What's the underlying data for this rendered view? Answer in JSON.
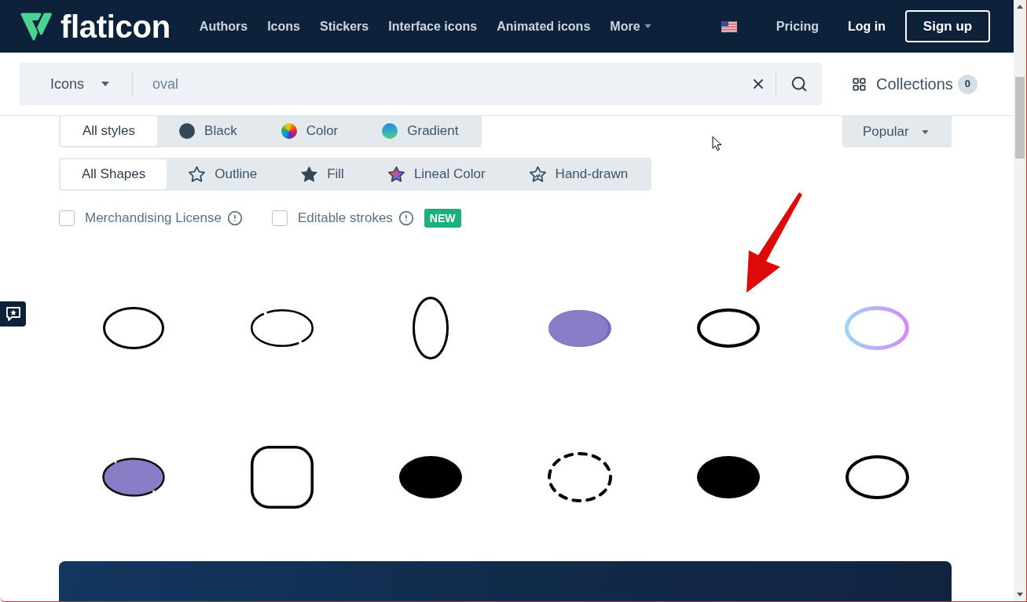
{
  "header": {
    "logo": "flaticon",
    "nav": [
      {
        "label": "Authors",
        "kind": "link"
      },
      {
        "label": "Icons",
        "kind": "link"
      },
      {
        "label": "Stickers",
        "kind": "link"
      },
      {
        "label": "Interface icons",
        "kind": "link"
      },
      {
        "label": "Animated icons",
        "kind": "link"
      },
      {
        "label": "More",
        "kind": "dropdown"
      }
    ],
    "pricing": "Pricing",
    "login": "Log in",
    "signup": "Sign up"
  },
  "search": {
    "category": "Icons",
    "value": "oval"
  },
  "collections": {
    "label": "Collections",
    "count": "0"
  },
  "style_filters": [
    {
      "label": "All styles",
      "kind": "all",
      "selected": true
    },
    {
      "label": "Black",
      "kind": "black",
      "selected": false
    },
    {
      "label": "Color",
      "kind": "color",
      "selected": false
    },
    {
      "label": "Gradient",
      "kind": "gradient",
      "selected": false
    }
  ],
  "sort": {
    "label": "Popular"
  },
  "shape_filters": [
    {
      "label": "All Shapes",
      "kind": "all",
      "selected": true
    },
    {
      "label": "Outline",
      "kind": "outline",
      "selected": false
    },
    {
      "label": "Fill",
      "kind": "fill",
      "selected": false
    },
    {
      "label": "Lineal Color",
      "kind": "lineal",
      "selected": false
    },
    {
      "label": "Hand-drawn",
      "kind": "handdrawn",
      "selected": false
    }
  ],
  "options": [
    {
      "label": "Merchandising License",
      "checked": false
    },
    {
      "label": "Editable strokes",
      "checked": false,
      "badge": "NEW"
    }
  ],
  "results": [
    {
      "kind": "outline"
    },
    {
      "kind": "broken"
    },
    {
      "kind": "vertical"
    },
    {
      "kind": "filled"
    },
    {
      "kind": "bold"
    },
    {
      "kind": "gradient"
    },
    {
      "kind": "lineal"
    },
    {
      "kind": "squircle"
    },
    {
      "kind": "solid"
    },
    {
      "kind": "dashed"
    },
    {
      "kind": "solid"
    },
    {
      "kind": "thick"
    }
  ]
}
